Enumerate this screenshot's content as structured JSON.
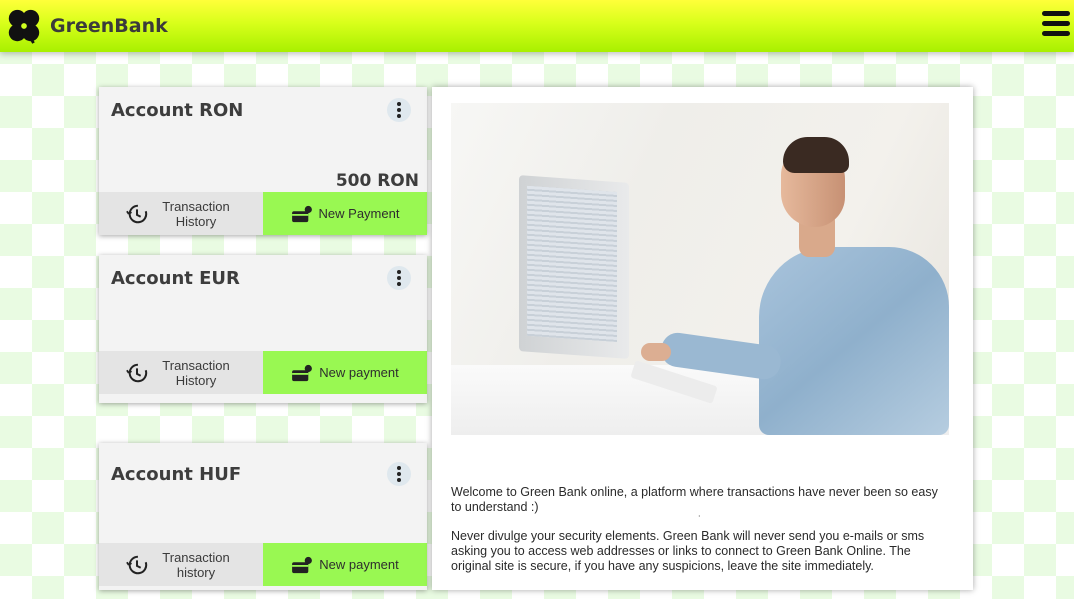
{
  "app": {
    "brand": "GreenBank"
  },
  "accounts": [
    {
      "title": "Account RON",
      "balance": "500 RON",
      "history_label": "Transaction History",
      "payment_label": "New Payment"
    },
    {
      "title": "Account EUR",
      "balance": "",
      "history_label": "Transaction History",
      "payment_label": "New payment"
    },
    {
      "title": "Account HUF",
      "balance": "",
      "history_label": "Transaction history",
      "payment_label": "New payment"
    }
  ],
  "intro": {
    "welcome": "Welcome to Green Bank online, a platform where transactions have never been so easy to understand :)",
    "security": "Never divulge your security elements. Green Bank will never send you e-mails or sms asking you to access web addresses or links to connect to Green Bank Online. The original site is secure, if you have any suspicions, leave the site immediately."
  },
  "icons": {
    "logo": "clover-logo-icon",
    "menu": "hamburger-menu-icon",
    "kebab": "more-vertical-icon",
    "history": "history-icon",
    "payment": "payment-card-icon"
  },
  "colors": {
    "header_top": "#ffff3a",
    "header_bottom": "#a8f000",
    "payment_button": "#99f852",
    "history_button": "#e4e4e4",
    "background_check": "#e9fbe2"
  }
}
